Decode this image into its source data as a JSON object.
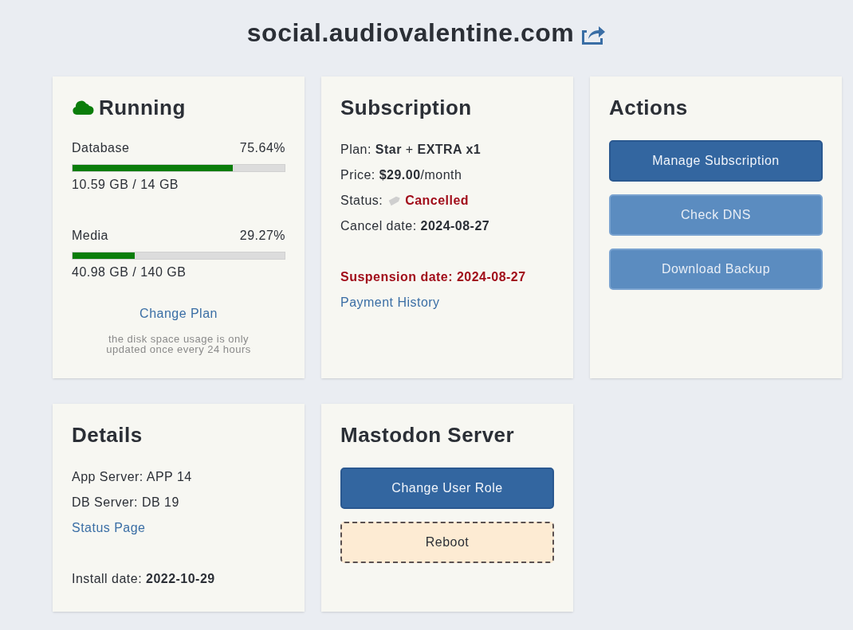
{
  "header": {
    "title": "social.audiovalentine.com"
  },
  "status_card": {
    "title": "Running",
    "online": true,
    "meters": [
      {
        "label": "Database",
        "reading": "75.64%",
        "level": 0.7564,
        "usage": "10.59 GB / 14 GB"
      },
      {
        "label": "Media",
        "reading": "29.27%",
        "level": 0.2927,
        "usage": "40.98 GB / 140 GB"
      }
    ],
    "link": "Change Plan",
    "note": "the disk space usage is only updated once every 24 hours"
  },
  "subscription_card": {
    "title": "Subscription",
    "lines": [
      "Plan: **Star** + **EXTRA x1**",
      "Price: **$29.00**/month"
    ],
    "status_label": "Status:",
    "status_value": "Cancelled",
    "cancel_line": "Cancel date: **2024-08-27**",
    "suspension": "Suspension date: 2024-08-27",
    "link": "Payment History"
  },
  "actions_card": {
    "title": "Actions",
    "buttons": [
      {
        "label": "Manage Subscription",
        "kind": "primary",
        "disabled": false
      },
      {
        "label": "Check DNS",
        "kind": "primary",
        "disabled": true
      },
      {
        "label": "Download Backup",
        "kind": "primary",
        "disabled": true
      }
    ]
  },
  "details_card": {
    "title": "Details",
    "lines": [
      "App Server: APP 14",
      "DB Server: DB 19"
    ],
    "link": "Status Page",
    "install_line": "Install date: **2022-10-29**"
  },
  "server_card": {
    "title": "Mastodon Server",
    "buttons": [
      {
        "label": "Change User Role",
        "kind": "primary",
        "disabled": false
      },
      {
        "label": "Reboot",
        "kind": "warning",
        "disabled": false
      }
    ]
  }
}
